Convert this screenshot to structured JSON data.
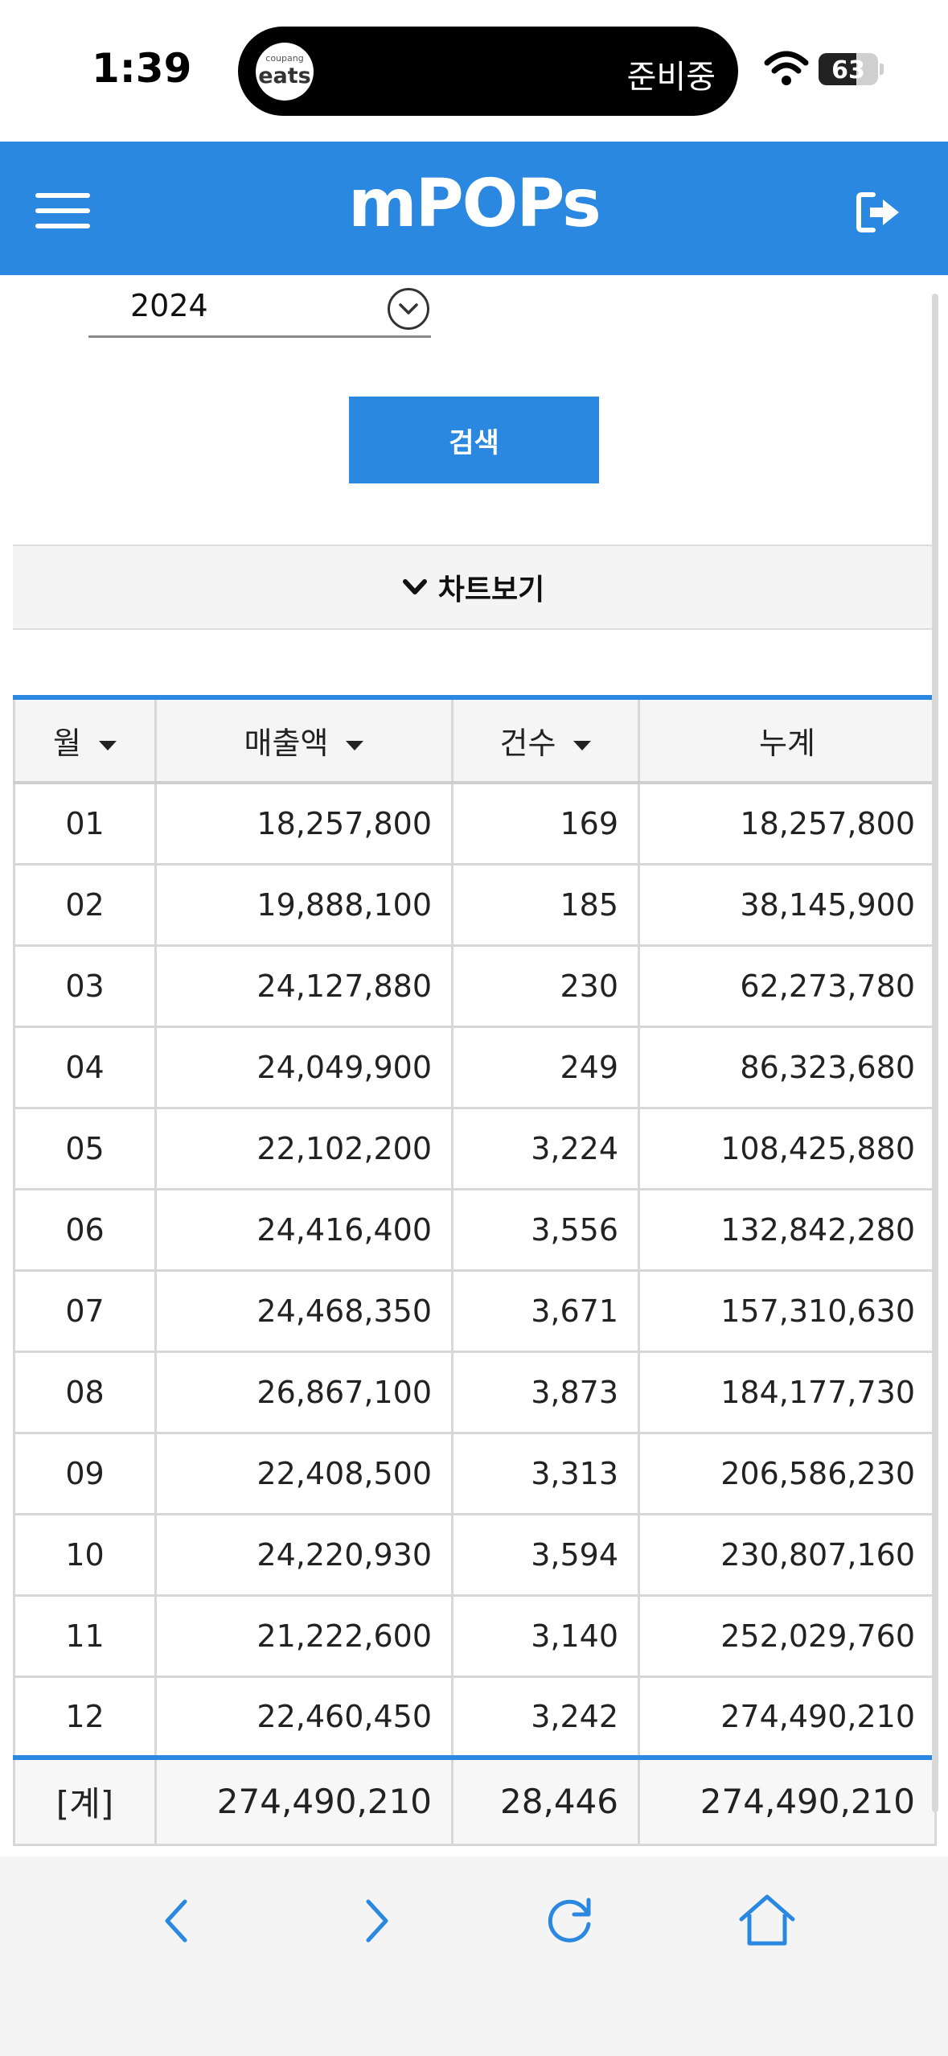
{
  "status_bar": {
    "time": "1:39",
    "island_logo_small": "coupang",
    "island_logo_big": "eats",
    "island_status": "준비중",
    "battery_level": "63",
    "battery_fraction": 0.63
  },
  "header": {
    "title": "mPOPs",
    "menu_icon": "hamburger-menu-icon",
    "logout_icon": "logout-icon",
    "color": "#2b88e0"
  },
  "filter": {
    "year": "2024",
    "search_label": "검색",
    "chart_toggle_label": "차트보기"
  },
  "table": {
    "headers": {
      "month": "월",
      "sales": "매출액",
      "count": "건수",
      "cumulative": "누계"
    },
    "rows": [
      {
        "month": "01",
        "sales": "18,257,800",
        "count": "169",
        "cumulative": "18,257,800"
      },
      {
        "month": "02",
        "sales": "19,888,100",
        "count": "185",
        "cumulative": "38,145,900"
      },
      {
        "month": "03",
        "sales": "24,127,880",
        "count": "230",
        "cumulative": "62,273,780"
      },
      {
        "month": "04",
        "sales": "24,049,900",
        "count": "249",
        "cumulative": "86,323,680"
      },
      {
        "month": "05",
        "sales": "22,102,200",
        "count": "3,224",
        "cumulative": "108,425,880"
      },
      {
        "month": "06",
        "sales": "24,416,400",
        "count": "3,556",
        "cumulative": "132,842,280"
      },
      {
        "month": "07",
        "sales": "24,468,350",
        "count": "3,671",
        "cumulative": "157,310,630"
      },
      {
        "month": "08",
        "sales": "26,867,100",
        "count": "3,873",
        "cumulative": "184,177,730"
      },
      {
        "month": "09",
        "sales": "22,408,500",
        "count": "3,313",
        "cumulative": "206,586,230"
      },
      {
        "month": "10",
        "sales": "24,220,930",
        "count": "3,594",
        "cumulative": "230,807,160"
      },
      {
        "month": "11",
        "sales": "21,222,600",
        "count": "3,140",
        "cumulative": "252,029,760"
      },
      {
        "month": "12",
        "sales": "22,460,450",
        "count": "3,242",
        "cumulative": "274,490,210"
      }
    ],
    "total": {
      "label": "[계]",
      "sales": "274,490,210",
      "count": "28,446",
      "cumulative": "274,490,210"
    }
  },
  "toolbar": {
    "icons": [
      "back-icon",
      "forward-icon",
      "reload-icon",
      "home-icon"
    ],
    "icon_color": "#2b88e0"
  }
}
